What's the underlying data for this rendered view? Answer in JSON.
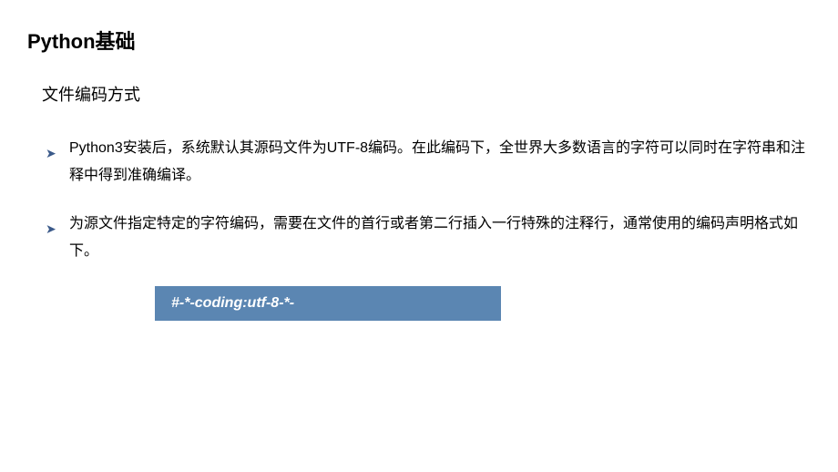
{
  "title": "Python基础",
  "subtitle": "文件编码方式",
  "bullets": [
    "Python3安装后，系统默认其源码文件为UTF-8编码。在此编码下，全世界大多数语言的字符可以同时在字符串和注释中得到准确编译。",
    "为源文件指定特定的字符编码，需要在文件的首行或者第二行插入一行特殊的注释行，通常使用的编码声明格式如下。"
  ],
  "code_line": "#-*-coding:utf-8-*-",
  "bullet_marker": "➤"
}
